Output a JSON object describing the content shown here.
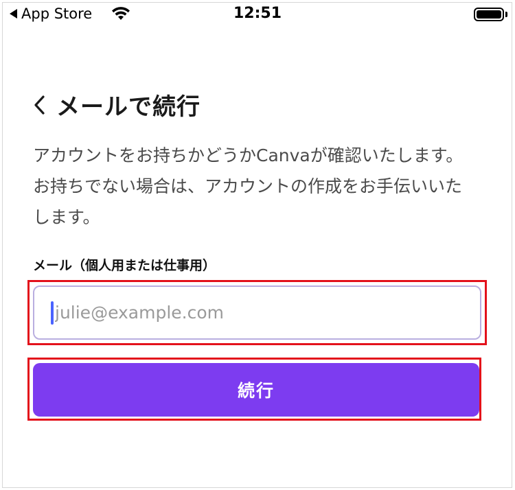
{
  "status_bar": {
    "back_app_label": "App Store",
    "time": "12:51"
  },
  "header": {
    "title": "メールで続行"
  },
  "description": "アカウントをお持ちかどうかCanvaが確認いたします。お持ちでない場合は、アカウントの作成をお手伝いいたします。",
  "email": {
    "label": "メール（個人用または仕事用）",
    "placeholder": "julie@example.com",
    "value": ""
  },
  "continue_button": {
    "label": "続行",
    "color": "#7d3cf0"
  },
  "highlight_color": "#e3111b"
}
